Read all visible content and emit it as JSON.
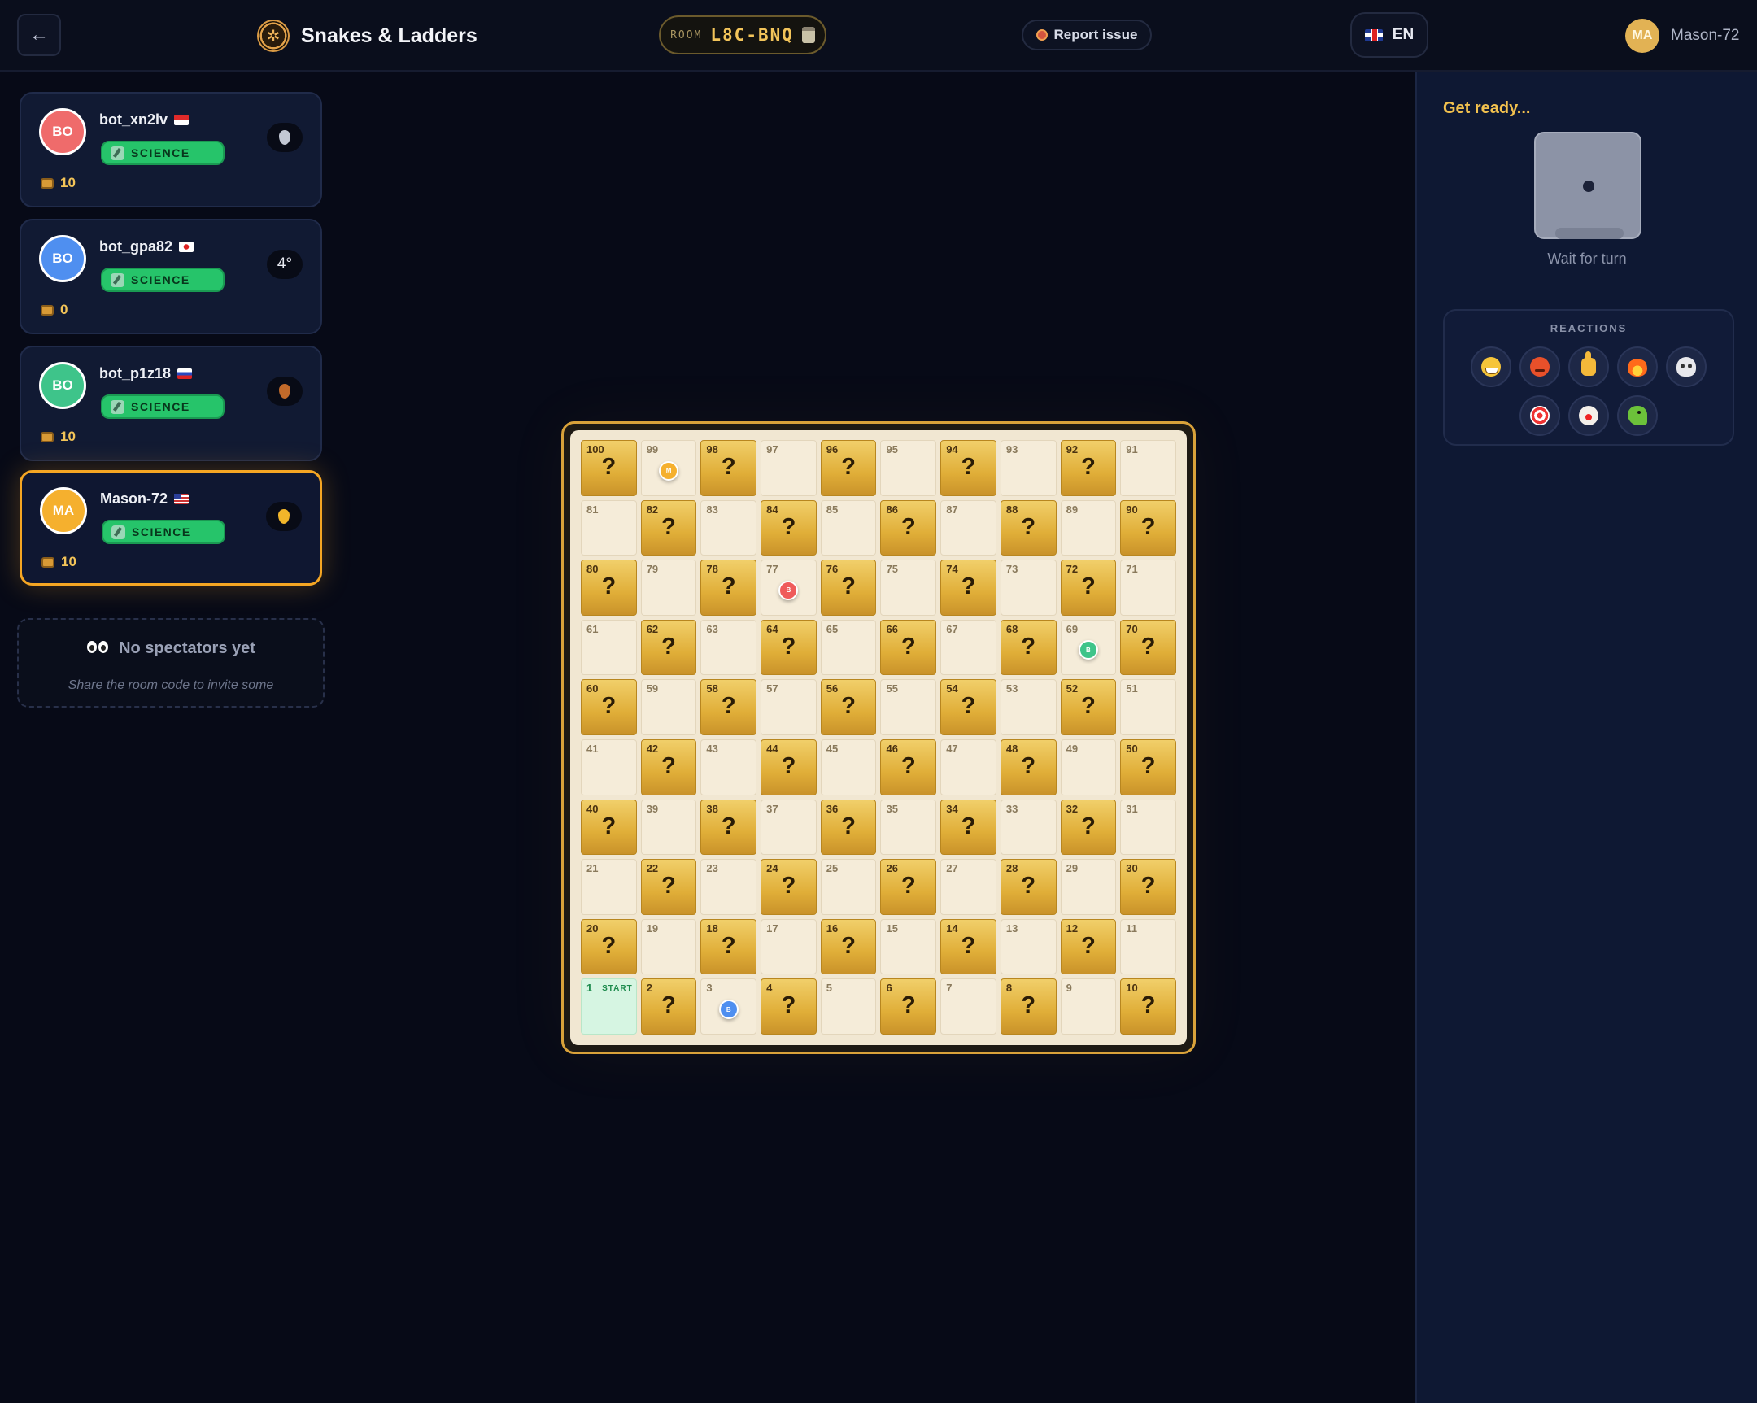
{
  "header": {
    "back_icon": "arrow-left-icon",
    "title": "Snakes & Ladders",
    "room_label": "ROOM",
    "room_code": "L8C-BNQ",
    "report_label": "Report issue",
    "lang_label": "EN",
    "user_initials": "MA",
    "user_name": "Mason-72"
  },
  "players": [
    {
      "initials": "BO",
      "name": "bot_xn2lv",
      "flag": "flag-id",
      "category": "SCIENCE",
      "score": "10",
      "rank": "",
      "medal": "medal-silver",
      "color": "#ef6b6b"
    },
    {
      "initials": "BO",
      "name": "bot_gpa82",
      "flag": "flag-jp",
      "category": "SCIENCE",
      "score": "0",
      "rank": "4°",
      "medal": "",
      "color": "#4f8ff0"
    },
    {
      "initials": "BO",
      "name": "bot_p1z18",
      "flag": "flag-ru",
      "category": "SCIENCE",
      "score": "10",
      "rank": "",
      "medal": "medal-bronze",
      "color": "#3ec48a"
    },
    {
      "initials": "MA",
      "name": "Mason-72",
      "flag": "flag-us",
      "category": "SCIENCE",
      "score": "10",
      "rank": "",
      "medal": "medal-gold",
      "color": "#f5b02e"
    }
  ],
  "spectators": {
    "title": "No spectators yet",
    "subtitle": "Share the room code to invite some"
  },
  "board": {
    "start_label": "START",
    "question_mark": "?",
    "tokens": [
      {
        "cell": 99,
        "initial": "M",
        "color": "#f5b02e"
      },
      {
        "cell": 77,
        "initial": "B",
        "color": "#ef5b5b"
      },
      {
        "cell": 69,
        "initial": "B",
        "color": "#3ec48a"
      },
      {
        "cell": 3,
        "initial": "B",
        "color": "#4f8ff0"
      }
    ]
  },
  "right_panel": {
    "status": "Get ready...",
    "wait_text": "Wait for turn",
    "dice_value": 1,
    "reactions_title": "REACTIONS",
    "reactions": [
      "grin-emoji",
      "angry-emoji",
      "thumbs-up-emoji",
      "fire-emoji",
      "skull-emoji",
      "target-emoji",
      "clown-emoji",
      "snake-emoji"
    ]
  }
}
